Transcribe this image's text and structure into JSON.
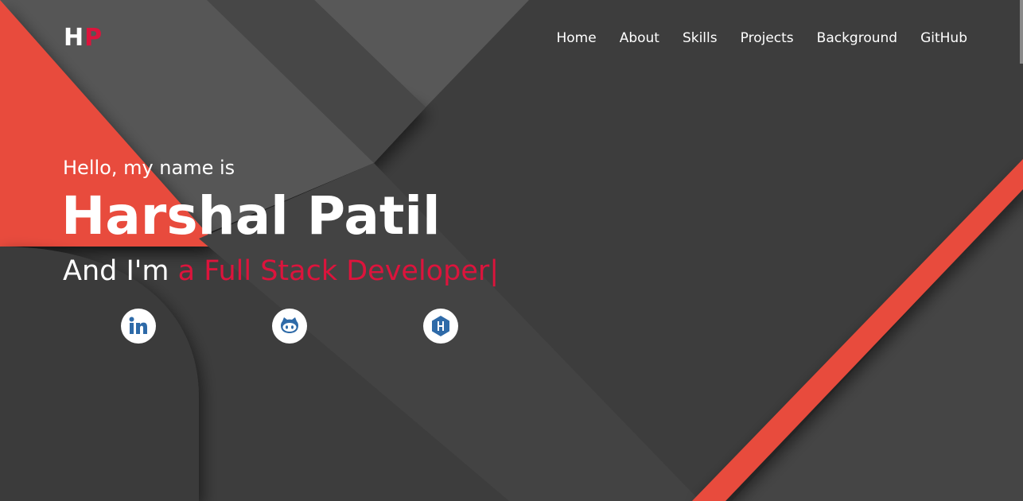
{
  "brand": {
    "initial_1": "H",
    "initial_2": "P"
  },
  "nav": {
    "items": [
      "Home",
      "About",
      "Skills",
      "Projects",
      "Background",
      "GitHub"
    ]
  },
  "hero": {
    "greeting": "Hello, my name is",
    "name": "Harshal Patil",
    "role_prefix": "And I'm",
    "role_typed": "a Full Stack Developer",
    "cursor": "|"
  },
  "social": [
    {
      "icon": "linkedin-icon"
    },
    {
      "icon": "github-icon"
    },
    {
      "icon": "hackerrank-icon"
    }
  ],
  "colors": {
    "background": "#3d3d3d",
    "accent_red": "#e84b3c",
    "highlight": "#dc143c",
    "panel_light": "#575757",
    "text": "#ffffff",
    "icon_blue": "#2e6aa8"
  }
}
